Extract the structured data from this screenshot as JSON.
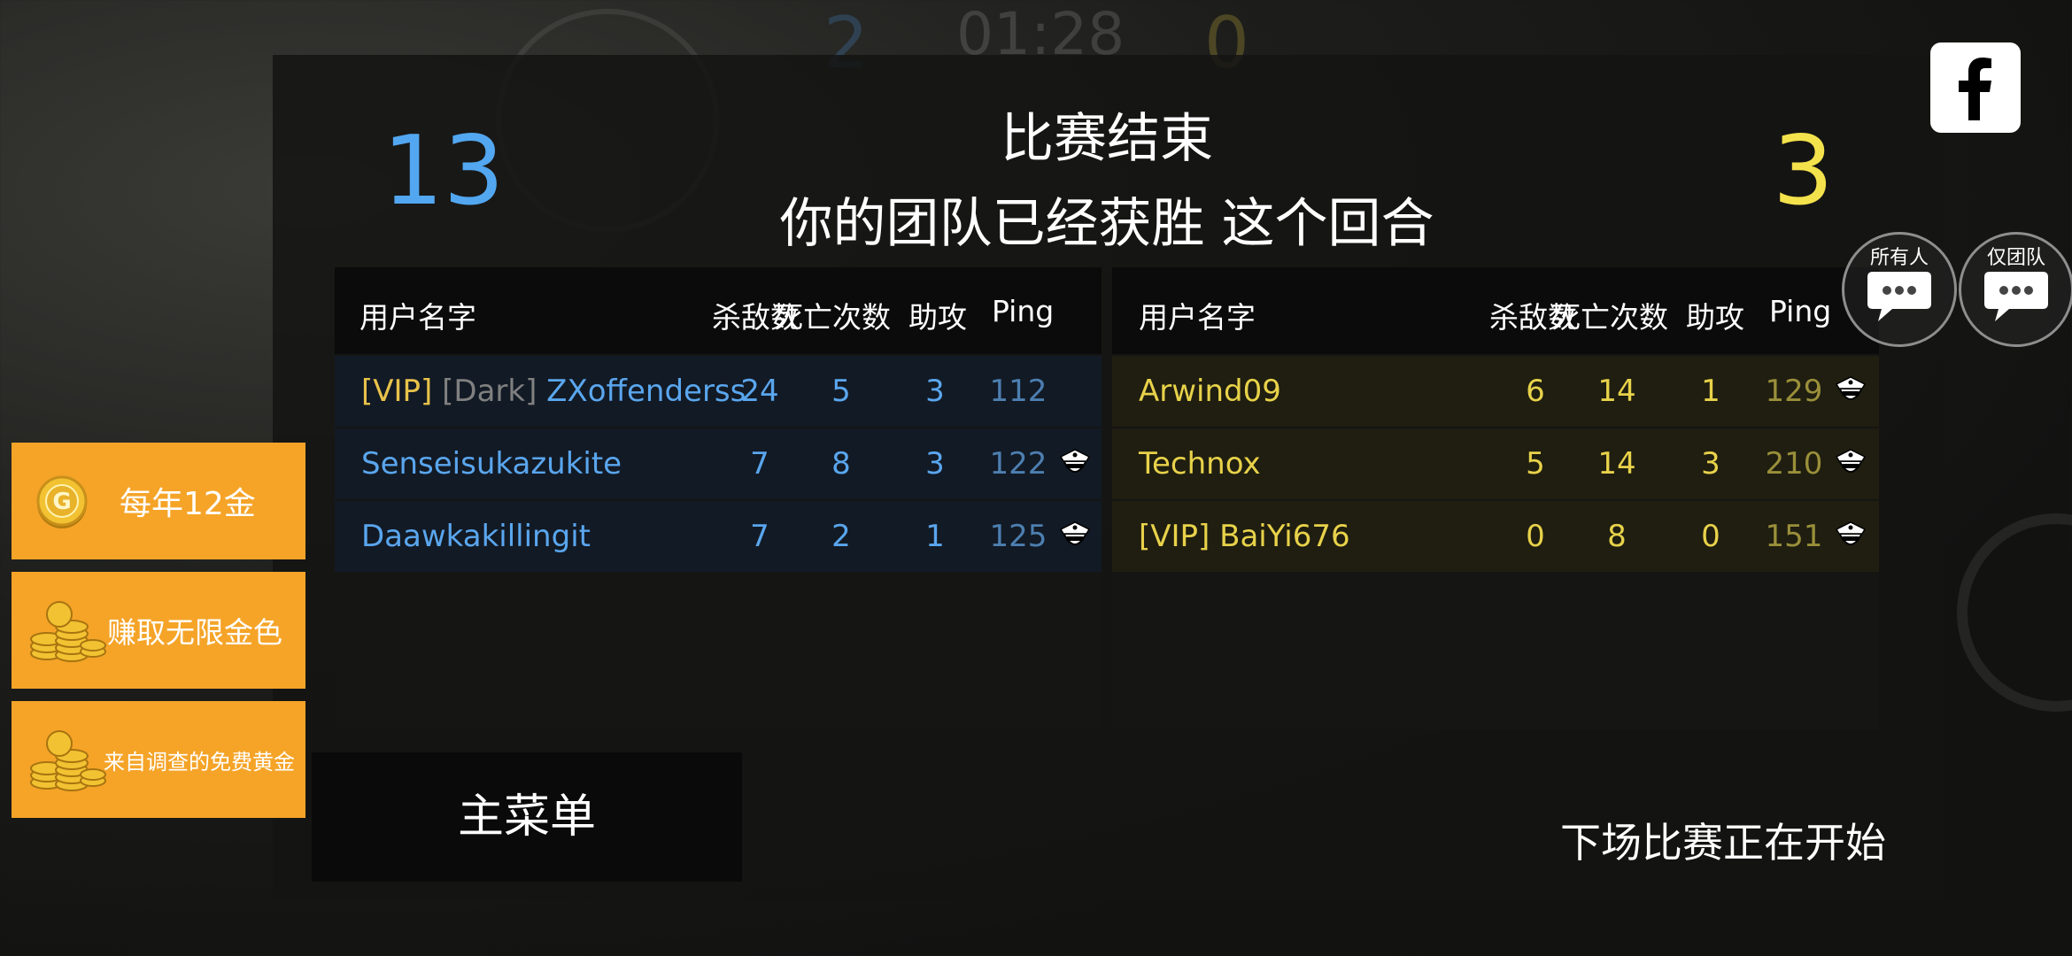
{
  "background": {
    "team_score_blue": "2",
    "timer": "01:28",
    "team_score_yellow": "0"
  },
  "header": {
    "title": "比赛结束",
    "subtitle": "你的团队已经获胜 这个回合",
    "score_blue": "13",
    "score_yellow": "3"
  },
  "columns": {
    "username": "用户名字",
    "kills": "杀敌数",
    "deaths": "死亡次数",
    "assists": "助攻",
    "ping": "Ping"
  },
  "team_blue": [
    {
      "prefix": "[VIP]",
      "tag": "[Dark]",
      "name": "ZXoffenderss",
      "kills": "24",
      "deaths": "5",
      "assists": "3",
      "ping": "112",
      "icon": "police-officer-icon",
      "show_icon": false
    },
    {
      "prefix": "",
      "tag": "",
      "name": "Senseisukazukite",
      "kills": "7",
      "deaths": "8",
      "assists": "3",
      "ping": "122",
      "icon": "police-officer-icon",
      "show_icon": true
    },
    {
      "prefix": "",
      "tag": "",
      "name": "Daawkakillingit",
      "kills": "7",
      "deaths": "2",
      "assists": "1",
      "ping": "125",
      "icon": "police-officer-icon",
      "show_icon": true
    }
  ],
  "team_yellow": [
    {
      "name": "Arwind09",
      "kills": "6",
      "deaths": "14",
      "assists": "1",
      "ping": "129",
      "icon": "police-officer-icon"
    },
    {
      "name": "Technox",
      "kills": "5",
      "deaths": "14",
      "assists": "3",
      "ping": "210",
      "icon": "police-officer-icon"
    },
    {
      "name": "[VIP] BaiYi676",
      "kills": "0",
      "deaths": "8",
      "assists": "0",
      "ping": "151",
      "icon": "police-officer-icon"
    }
  ],
  "promos": [
    {
      "label": "每年12金",
      "icon": "gold-coin-icon"
    },
    {
      "label": "赚取无限金色",
      "icon": "coin-stack-icon"
    },
    {
      "label": "来自调查的免费黄金",
      "icon": "coin-stack-icon"
    }
  ],
  "buttons": {
    "main_menu": "主菜单"
  },
  "status": {
    "next_match": "下场比赛正在开始"
  },
  "chat": {
    "all": "所有人",
    "team": "仅团队"
  },
  "colors": {
    "blue_team": "#52a7f0",
    "yellow_team": "#f4e24c",
    "promo_orange": "#f5a428"
  }
}
